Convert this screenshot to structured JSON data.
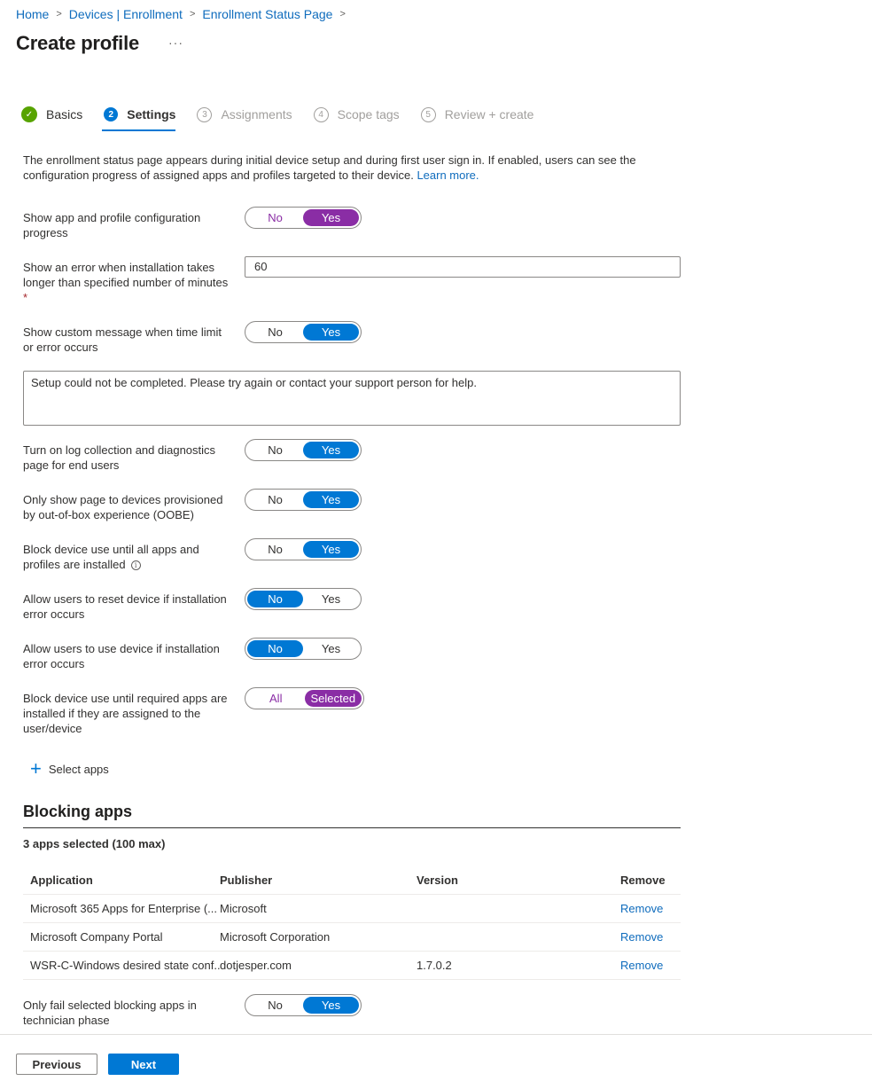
{
  "breadcrumb": [
    {
      "label": "Home"
    },
    {
      "label": "Devices | Enrollment"
    },
    {
      "label": "Enrollment Status Page"
    }
  ],
  "page_title": "Create profile",
  "more_label": "···",
  "steps": [
    {
      "number": "✓",
      "label": "Basics",
      "state": "done"
    },
    {
      "number": "2",
      "label": "Settings",
      "state": "current"
    },
    {
      "number": "3",
      "label": "Assignments",
      "state": "future"
    },
    {
      "number": "4",
      "label": "Scope tags",
      "state": "future"
    },
    {
      "number": "5",
      "label": "Review + create",
      "state": "future"
    }
  ],
  "intro": {
    "text": "The enrollment status page appears during initial device setup and during first user sign in. If enabled, users can see the configuration progress of assigned apps and profiles targeted to their device. ",
    "link": "Learn more."
  },
  "settings": {
    "show_progress": {
      "label": "Show app and profile configuration progress",
      "options": [
        "No",
        "Yes"
      ],
      "selected": "Yes"
    },
    "error_minutes": {
      "label": "Show an error when installation takes longer than specified number of minutes",
      "required_mark": "*",
      "value": "60"
    },
    "custom_message": {
      "label": "Show custom message when time limit or error occurs",
      "options": [
        "No",
        "Yes"
      ],
      "selected": "Yes",
      "message": "Setup could not be completed. Please try again or contact your support person for help."
    },
    "log_collection": {
      "label": "Turn on log collection and diagnostics page for end users",
      "options": [
        "No",
        "Yes"
      ],
      "selected": "Yes"
    },
    "oobe_only": {
      "label": "Only show page to devices provisioned by out-of-box experience (OOBE)",
      "options": [
        "No",
        "Yes"
      ],
      "selected": "Yes"
    },
    "block_device": {
      "label": "Block device use until all apps and profiles are installed",
      "info_icon": "i",
      "options": [
        "No",
        "Yes"
      ],
      "selected": "Yes"
    },
    "allow_reset": {
      "label": "Allow users to reset device if installation error occurs",
      "options": [
        "No",
        "Yes"
      ],
      "selected": "No"
    },
    "allow_use": {
      "label": "Allow users to use device if installation error occurs",
      "options": [
        "No",
        "Yes"
      ],
      "selected": "No"
    },
    "block_required": {
      "label": "Block device use until required apps are installed if they are assigned to the user/device",
      "options": [
        "All",
        "Selected"
      ],
      "selected": "Selected"
    },
    "only_fail_selected": {
      "label": "Only fail selected blocking apps in technician phase",
      "options": [
        "No",
        "Yes"
      ],
      "selected": "Yes"
    }
  },
  "select_apps_label": "Select apps",
  "blocking_apps": {
    "title": "Blocking apps",
    "count_label": "3 apps selected (100 max)",
    "columns": [
      "Application",
      "Publisher",
      "Version",
      "Remove"
    ],
    "rows": [
      {
        "application": "Microsoft 365 Apps for Enterprise (...",
        "publisher": "Microsoft",
        "version": "",
        "action": "Remove"
      },
      {
        "application": "Microsoft Company Portal",
        "publisher": "Microsoft Corporation",
        "version": "",
        "action": "Remove"
      },
      {
        "application": "WSR-C-Windows desired state conf...",
        "publisher": "dotjesper.com",
        "version": "1.7.0.2",
        "action": "Remove"
      }
    ]
  },
  "footer": {
    "previous": "Previous",
    "next": "Next"
  },
  "colors": {
    "accent": "#0078d4",
    "purple": "#8a2da5",
    "success": "#57a300",
    "link": "#0f6cbd"
  }
}
